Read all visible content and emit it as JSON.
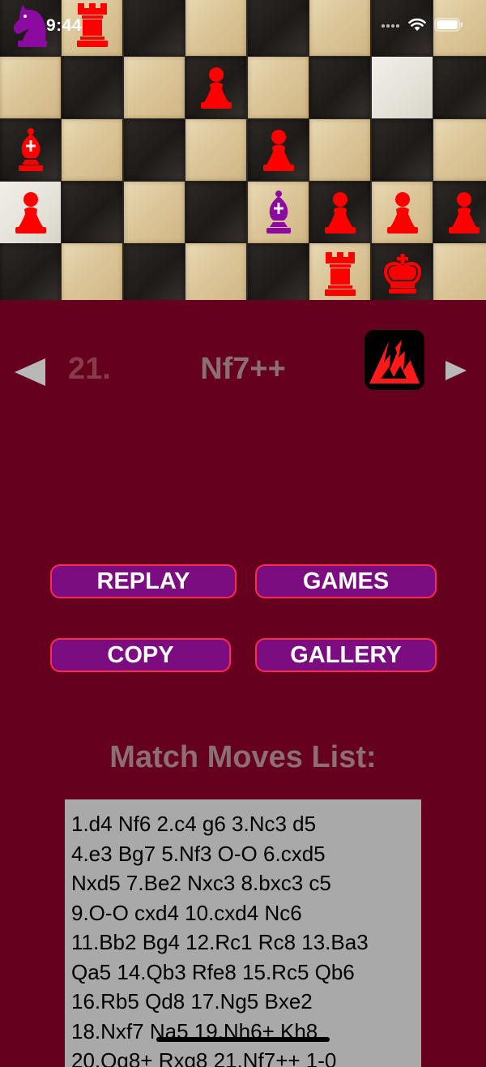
{
  "status_bar": {
    "time": "9:44"
  },
  "board": {
    "rows": [
      [
        "dark",
        "light",
        "dark",
        "light",
        "dark",
        "light",
        "dark",
        "light"
      ],
      [
        "light",
        "dark",
        "light",
        "dark",
        "light",
        "dark",
        "lighter",
        "dark"
      ],
      [
        "dark",
        "light",
        "dark",
        "light",
        "dark",
        "light",
        "dark",
        "light"
      ],
      [
        "lighter",
        "dark",
        "light",
        "dark",
        "light",
        "dark",
        "light",
        "dark"
      ],
      [
        "dark",
        "light",
        "dark",
        "light",
        "dark",
        "light",
        "dark",
        "light"
      ]
    ],
    "pieces": [
      {
        "type": "knight",
        "color": "#8b0aa0",
        "col": 0,
        "row": 0
      },
      {
        "type": "rook",
        "color": "#ff0000",
        "col": 1,
        "row": 0
      },
      {
        "type": "pawn",
        "color": "#ff0000",
        "col": 3,
        "row": 1
      },
      {
        "type": "bishop",
        "color": "#ff0000",
        "col": 0,
        "row": 2
      },
      {
        "type": "pawn",
        "color": "#ff0000",
        "col": 4,
        "row": 2
      },
      {
        "type": "pawn",
        "color": "#ff0000",
        "col": 0,
        "row": 3
      },
      {
        "type": "bishop",
        "color": "#8b0aa0",
        "col": 4,
        "row": 3
      },
      {
        "type": "pawn",
        "color": "#ff0000",
        "col": 5,
        "row": 3
      },
      {
        "type": "pawn",
        "color": "#ff0000",
        "col": 6,
        "row": 3
      },
      {
        "type": "pawn",
        "color": "#ff0000",
        "col": 7,
        "row": 3
      },
      {
        "type": "rook",
        "color": "#ff0000",
        "col": 5,
        "row": 4
      },
      {
        "type": "king",
        "color": "#ff0000",
        "col": 6,
        "row": 4
      }
    ]
  },
  "navigation": {
    "move_number": "21.",
    "move": "Nf7++"
  },
  "buttons": {
    "replay": "REPLAY",
    "games": "GAMES",
    "copy": "COPY",
    "gallery": "GALLERY"
  },
  "moves_list": {
    "title": "Match Moves List:",
    "text": "1.d4 Nf6 2.c4 g6 3.Nc3 d5\n4.e3 Bg7 5.Nf3 O-O 6.cxd5\nNxd5 7.Be2 Nxc3 8.bxc3 c5\n9.O-O cxd4 10.cxd4 Nc6\n11.Bb2 Bg4 12.Rc1 Rc8 13.Ba3\nQa5 14.Qb3 Rfe8 15.Rc5 Qb6\n16.Rb5 Qd8 17.Ng5 Bxe2\n18.Nxf7 Na5 19.Nh6+ Kh8\n20.Qg8+ Rxg8 21.Nf7++ 1-0"
  },
  "colors": {
    "background": "#65001e",
    "button_fill": "#7c0d80",
    "button_border": "#ff2a4e",
    "piece_red": "#ff0000",
    "piece_purple": "#8b0aa0"
  }
}
